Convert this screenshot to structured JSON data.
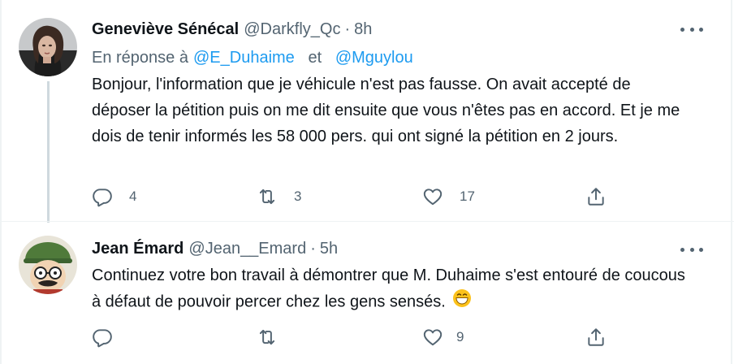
{
  "tweets": [
    {
      "author_name": "Geneviève Sénécal",
      "handle": "@Darkfly_Qc",
      "separator": "·",
      "time": "8h",
      "reply_prefix": "En réponse à",
      "reply_to": [
        "@E_Duhaime",
        "@Mguylou"
      ],
      "reply_joiner": "et",
      "text": "Bonjour, l'information que je véhicule n'est pas fausse. On avait accepté de déposer la pétition puis on me dit ensuite que vous n'êtes pas en accord. Et je me dois de tenir informés les 58 000 pers. qui ont signé la pétition en 2 jours.",
      "avatar_icon": "user-photo-avatar",
      "counts": {
        "reply": "4",
        "retweet": "3",
        "like": "17"
      }
    },
    {
      "author_name": "Jean Émard",
      "handle": "@Jean__Emard",
      "separator": "·",
      "time": "5h",
      "text": "Continuez votre bon travail à démontrer que M. Duhaime s'est entouré de coucous à défaut de pouvoir percer chez les gens sensés.",
      "emoji_icon": "grinning-face-emoji",
      "avatar_icon": "cartoon-character-avatar",
      "counts": {
        "reply": "",
        "retweet": "",
        "like": "9"
      }
    }
  ],
  "icons": {
    "reply": "reply-icon",
    "retweet": "retweet-icon",
    "like": "heart-icon",
    "share": "share-icon",
    "more": "more-icon"
  },
  "colors": {
    "text": "#0f1419",
    "secondary": "#536471",
    "link": "#1d9bf0",
    "thread_line": "#cfd9de",
    "divider": "#eff3f4"
  }
}
